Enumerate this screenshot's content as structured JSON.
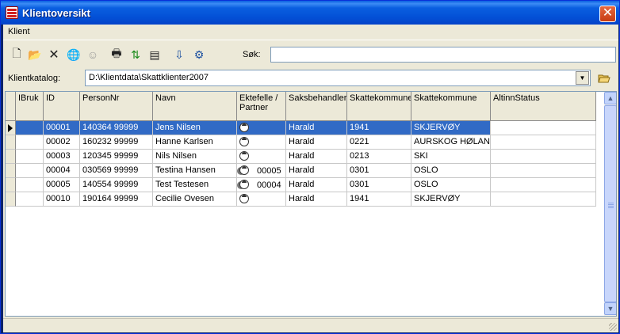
{
  "window": {
    "title": "Klientoversikt",
    "close_label": "✕"
  },
  "menu": {
    "items": [
      {
        "label": "Klient"
      }
    ]
  },
  "toolbar": {
    "buttons": [
      {
        "name": "new-file",
        "icon": "new-document-icon",
        "glyph": "🗋"
      },
      {
        "name": "open-folder",
        "icon": "open-folder-icon",
        "glyph": "📂"
      },
      {
        "name": "delete",
        "icon": "delete-icon",
        "glyph": "✕"
      },
      {
        "name": "globe-people",
        "icon": "globe-icon",
        "glyph": "🌐"
      },
      {
        "name": "face-disabled",
        "icon": "face-icon",
        "glyph": "☺"
      },
      {
        "name": "print",
        "icon": "printer-icon",
        "glyph": "🖶"
      },
      {
        "name": "refresh",
        "icon": "refresh-icon",
        "glyph": "⇅"
      },
      {
        "name": "report",
        "icon": "report-icon",
        "glyph": "▤"
      },
      {
        "name": "export",
        "icon": "export-icon",
        "glyph": "⇩"
      },
      {
        "name": "settings",
        "icon": "settings-icon",
        "glyph": "⚙"
      }
    ],
    "search_label": "Søk:",
    "search_value": ""
  },
  "catalog": {
    "label": "Klientkatalog:",
    "value": "D:\\Klientdata\\Skattklienter2007",
    "drop_glyph": "▼"
  },
  "grid": {
    "columns": [
      "IBruk",
      "ID",
      "PersonNr",
      "Navn",
      "Ektefelle / Partner",
      "Saksbehandler",
      "Skattekommune",
      "Skattekommune",
      "AltinnStatus"
    ],
    "rows": [
      {
        "ibruk": "",
        "id": "00001",
        "personnr": "140364 99999",
        "navn": "Jens Nilsen",
        "partner_icon": "single",
        "partner_id": "",
        "saksbehandler": "Harald",
        "kommune_nr": "1941",
        "kommune_navn": "SKJERVØY",
        "altinn": ""
      },
      {
        "ibruk": "",
        "id": "00002",
        "personnr": "160232 99999",
        "navn": "Hanne Karlsen",
        "partner_icon": "single",
        "partner_id": "",
        "saksbehandler": "Harald",
        "kommune_nr": "0221",
        "kommune_navn": "AURSKOG HØLAND",
        "altinn": ""
      },
      {
        "ibruk": "",
        "id": "00003",
        "personnr": "120345 99999",
        "navn": "Nils Nilsen",
        "partner_icon": "single",
        "partner_id": "",
        "saksbehandler": "Harald",
        "kommune_nr": "0213",
        "kommune_navn": "SKI",
        "altinn": ""
      },
      {
        "ibruk": "",
        "id": "00004",
        "personnr": "030569 99999",
        "navn": "Testina Hansen",
        "partner_icon": "pair",
        "partner_id": "00005",
        "saksbehandler": "Harald",
        "kommune_nr": "0301",
        "kommune_navn": "OSLO",
        "altinn": ""
      },
      {
        "ibruk": "",
        "id": "00005",
        "personnr": "140554 99999",
        "navn": "Test Testesen",
        "partner_icon": "pair",
        "partner_id": "00004",
        "saksbehandler": "Harald",
        "kommune_nr": "0301",
        "kommune_navn": "OSLO",
        "altinn": ""
      },
      {
        "ibruk": "",
        "id": "00010",
        "personnr": "190164 99999",
        "navn": "Cecilie Ovesen",
        "partner_icon": "single",
        "partner_id": "",
        "saksbehandler": "Harald",
        "kommune_nr": "1941",
        "kommune_navn": "SKJERVØY",
        "altinn": ""
      }
    ],
    "selected_row": 0
  },
  "colors": {
    "selection": "#316AC5",
    "titlebar": "#0A5FE0",
    "chrome": "#ECE9D8"
  }
}
